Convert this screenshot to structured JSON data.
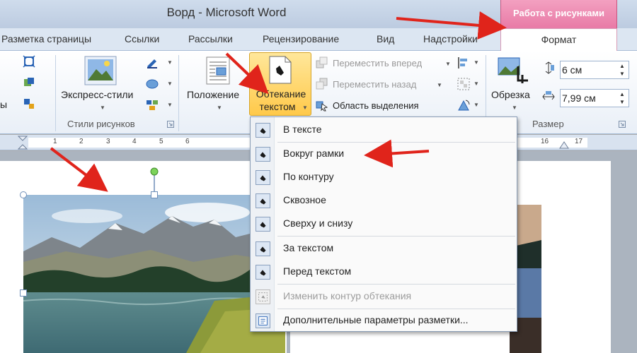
{
  "window": {
    "title": "Ворд  -  Microsoft Word",
    "context_tab": "Работа с рисунками"
  },
  "tabs": [
    {
      "label": "Разметка страницы"
    },
    {
      "label": "Ссылки"
    },
    {
      "label": "Рассылки"
    },
    {
      "label": "Рецензирование"
    },
    {
      "label": "Вид"
    },
    {
      "label": "Надстройки"
    },
    {
      "label": "Формат"
    }
  ],
  "ribbon": {
    "left_cut_label": "ы",
    "styles_group": {
      "express_styles": "Экспресс-стили",
      "label": "Стили рисунков"
    },
    "arrange_group": {
      "position": "Положение",
      "wrap_line1": "Обтекание",
      "wrap_line2": "текстом",
      "bring_forward": "Переместить вперед",
      "send_backward": "Переместить назад",
      "selection_pane": "Область выделения"
    },
    "size_group": {
      "crop": "Обрезка",
      "height_value": "6 см",
      "width_value": "7,99 см",
      "label": "Размер"
    }
  },
  "ruler": {
    "left_numbers": [
      "1",
      "2",
      "3",
      "4",
      "5",
      "6"
    ],
    "right_numbers": [
      "16",
      "17"
    ]
  },
  "wrap_menu": {
    "items": [
      {
        "label": "В тексте",
        "disabled": false
      },
      {
        "label": "Вокруг рамки",
        "disabled": false
      },
      {
        "label": "По контуру",
        "disabled": false
      },
      {
        "label": "Сквозное",
        "disabled": false
      },
      {
        "label": "Сверху и снизу",
        "disabled": false
      },
      {
        "label": "За текстом",
        "disabled": false
      },
      {
        "label": "Перед текстом",
        "disabled": false
      },
      {
        "label": "Изменить контур обтекания",
        "disabled": true
      },
      {
        "label": "Дополнительные параметры разметки...",
        "disabled": false
      }
    ]
  },
  "colors": {
    "context_tab": "#e87aa6",
    "highlight_button": "#ffc94a",
    "annotation_arrow": "#e0241b"
  }
}
